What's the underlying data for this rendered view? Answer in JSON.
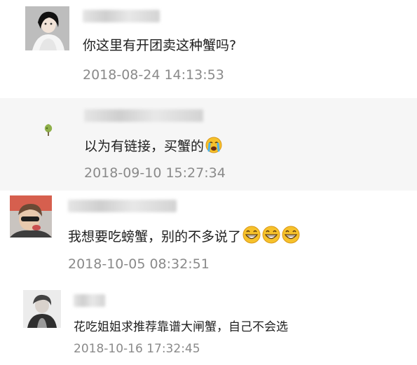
{
  "comments": [
    {
      "text": "你这里有开团卖这种蟹吗?",
      "time": "2018-08-24 14:13:53"
    },
    {
      "text": "以为有链接，买蟹的",
      "time": "2018-09-10 15:27:34",
      "emoji": "crying-emoji"
    },
    {
      "text": "我想要吃螃蟹，别的不多说了",
      "time": "2018-10-05 08:32:51",
      "emoji": "grinning-emoji"
    },
    {
      "text": "花吃姐姐求推荐靠谱大闸蟹，自己不会选",
      "time": "2018-10-16 17:32:45"
    }
  ],
  "colors": {
    "text": "#1f1f1f",
    "timestamp": "#8a8a8a",
    "reply_background": "#f6f6f6",
    "emoji_face": "#f6c12a"
  }
}
